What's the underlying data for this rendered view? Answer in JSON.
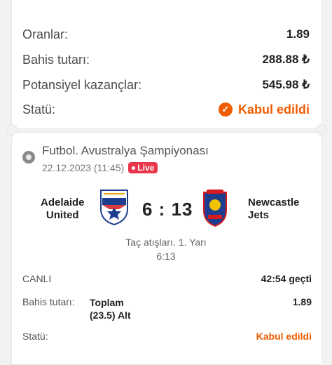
{
  "summary": {
    "odds_label": "Oranlar:",
    "odds_value": "1.89",
    "stake_label": "Bahis tutarı:",
    "stake_value": "288.88 ₺",
    "potential_label": "Potansiyel kazançlar:",
    "potential_value": "545.98 ₺",
    "status_label": "Statü:",
    "status_value": "Kabul edildi"
  },
  "match": {
    "league": "Futbol. Avustralya Şampiyonası",
    "datetime": "22.12.2023 (11:45)",
    "live_badge": "Live",
    "home_team": "Adelaide\nUnited",
    "away_team": "Newcastle\nJets",
    "score": "6 : 13",
    "market": "Taç atışları. 1. Yarı",
    "sub_score": "6:13",
    "live_label": "CANLI",
    "elapsed": "42:54 geçti"
  },
  "bet": {
    "stake_label": "Bahis tutarı:",
    "selection": "Toplam\n(23.5) Alt",
    "odds": "1.89",
    "status_label": "Statü:",
    "status_value": "Kabul edildi"
  },
  "colors": {
    "accent": "#ef5c00",
    "live": "#e8374d"
  }
}
